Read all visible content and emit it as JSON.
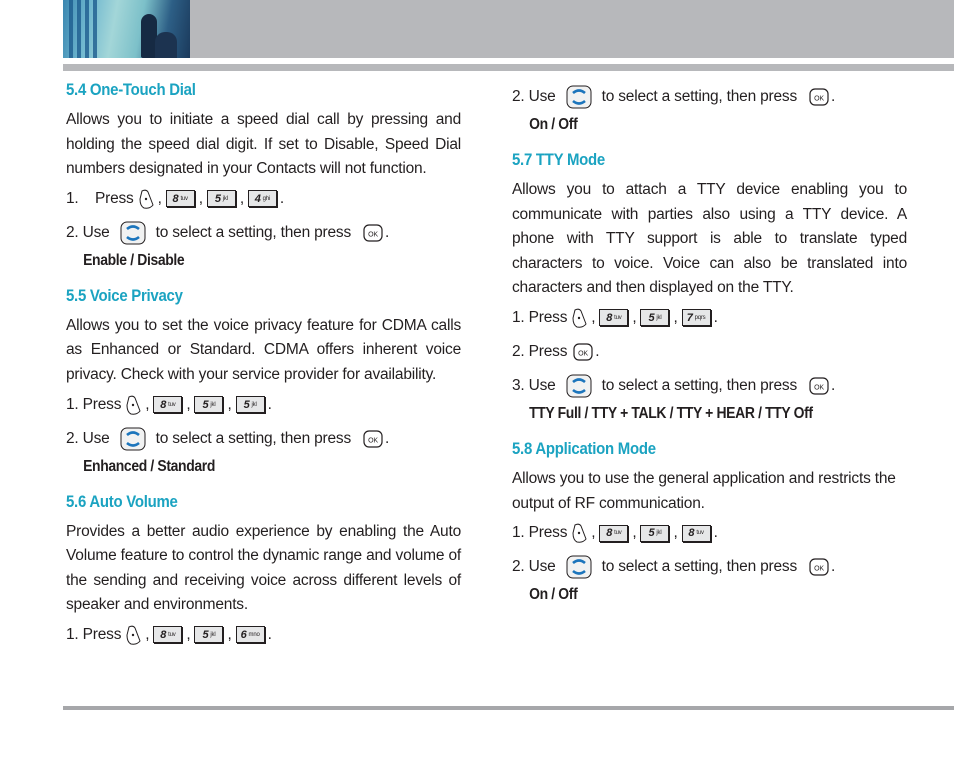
{
  "header": {
    "photo_alt": "header-photo",
    "band_color": "#b7b8bb"
  },
  "colors": {
    "heading": "#1ba3c1",
    "text": "#231f20",
    "rule": "#a6a7aa"
  },
  "sections": [
    {
      "title": "5.4 One-Touch Dial",
      "body": "Allows you to initiate a speed dial call by pressing and holding the speed dial digit. If set to Disable, Speed Dial numbers designated in your Contacts will not function.",
      "steps": [
        {
          "num": "1.",
          "label": "Press",
          "keys": [
            {
              "d": "8",
              "l": "tuv"
            },
            {
              "d": "5",
              "l": "jkl"
            },
            {
              "d": "4",
              "l": "ghi"
            }
          ]
        },
        {
          "num": "2.",
          "label": "Use",
          "mid": "to select a setting, then press"
        }
      ],
      "options": "Enable / Disable"
    },
    {
      "title": "5.5 Voice Privacy",
      "body": "Allows you to set the voice privacy feature for CDMA calls as Enhanced or Standard. CDMA offers inherent voice privacy. Check with your service provider for availability.",
      "steps": [
        {
          "num": "1.",
          "label": "Press",
          "keys": [
            {
              "d": "8",
              "l": "tuv"
            },
            {
              "d": "5",
              "l": "jkl"
            },
            {
              "d": "5",
              "l": "jkl"
            }
          ]
        },
        {
          "num": "2.",
          "label": "Use",
          "mid": "to select a setting, then press"
        }
      ],
      "options": "Enhanced / Standard"
    },
    {
      "title": "5.6 Auto Volume",
      "body": "Provides a better audio experience by enabling the Auto Volume feature to control the dynamic range and volume of the sending and receiving voice across different levels of speaker and environments.",
      "steps": [
        {
          "num": "1.",
          "label": "Press",
          "keys": [
            {
              "d": "8",
              "l": "tuv"
            },
            {
              "d": "5",
              "l": "jkl"
            },
            {
              "d": "6",
              "l": "mno"
            }
          ]
        },
        {
          "num": "2.",
          "label": "Use",
          "mid": "to select a setting, then press"
        }
      ],
      "options": "On / Off"
    },
    {
      "title": "5.7 TTY Mode",
      "body": "Allows you to attach a TTY device enabling you to communicate with parties also using a TTY device. A phone with TTY support is able to translate typed characters to voice. Voice can also be translated into characters and then displayed on the TTY.",
      "steps": [
        {
          "num": "1.",
          "label": "Press",
          "keys": [
            {
              "d": "8",
              "l": "tuv"
            },
            {
              "d": "5",
              "l": "jkl"
            },
            {
              "d": "7",
              "l": "pqrs"
            }
          ]
        },
        {
          "num": "2.",
          "label": "Press"
        },
        {
          "num": "3.",
          "label": "Use",
          "mid": "to select a setting, then press"
        }
      ],
      "options": "TTY Full / TTY + TALK / TTY + HEAR / TTY Off"
    },
    {
      "title": "5.8 Application Mode",
      "body": "Allows you to use the general application and restricts the output of RF communication.",
      "steps": [
        {
          "num": "1.",
          "label": "Press",
          "keys": [
            {
              "d": "8",
              "l": "tuv"
            },
            {
              "d": "5",
              "l": "jkl"
            },
            {
              "d": "8",
              "l": "tuv"
            }
          ]
        },
        {
          "num": "2.",
          "label": "Use",
          "mid": "to select a setting, then press"
        }
      ],
      "options": "On / Off"
    }
  ]
}
